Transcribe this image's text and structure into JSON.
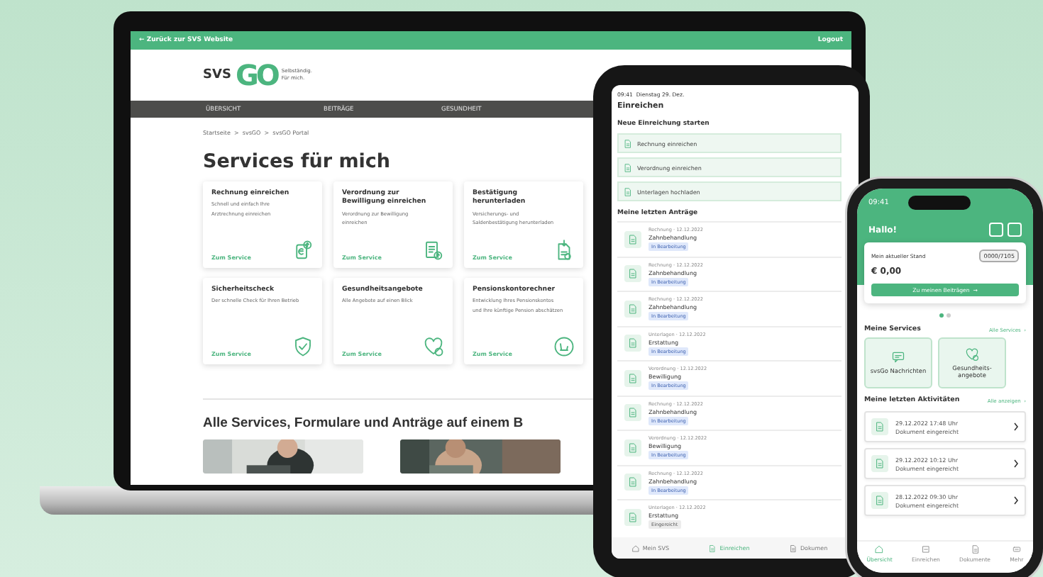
{
  "laptop": {
    "top_bar": {
      "back_link": "← Zurück zur SVS Website",
      "logout": "Logout"
    },
    "logo": {
      "brand": "SVS",
      "mark": "GO",
      "tagline": "Selbständig. Für mich."
    },
    "nav": [
      "ÜBERSICHT",
      "BEITRÄGE",
      "GESUNDHEIT"
    ],
    "breadcrumb": "Startseite  >  svsGO  >  svsGO Portal",
    "heading": "Services für mich",
    "services": [
      {
        "title": "Rechnung einreichen",
        "description": "Schnell und einfach Ihre Arztrechnung einreichen",
        "link": "Zum Service",
        "kind": "invoice"
      },
      {
        "title": "Verordnung zur Bewilligung einreichen",
        "description": "Verordnung zur Bewilligung einreichen",
        "link": "Zum Service",
        "kind": "prescription"
      },
      {
        "title": "Bestätigung herunterladen",
        "description": "Versicherungs- und Saldenbestätigung herunterladen",
        "link": "Zum Service",
        "kind": "download"
      },
      {
        "title": "Sicherheitscheck",
        "description": "Der schnelle Check für Ihren Betrieb",
        "link": "Zum Service",
        "kind": "shield"
      },
      {
        "title": "Gesundheitsangebote",
        "description": "Alle Angebote auf einen Blick",
        "link": "Zum Service",
        "kind": "heart"
      },
      {
        "title": "Pensionskontorechner",
        "description": "Entwicklung Ihres Pensionskontos und Ihre künftige Pension abschätzen",
        "link": "Zum Service",
        "kind": "pension"
      }
    ],
    "section_heading": "Alle Services, Formulare und Anträge auf einem B",
    "photos": [
      {
        "kind": "picture"
      },
      {
        "kind": "picture"
      }
    ]
  },
  "tablet": {
    "status": "09:41  Dienstag 29. Dez.",
    "title": "Einreichen",
    "start_heading": "Neue Einreichung starten",
    "actions": [
      "Rechnung einreichen",
      "Verordnung einreichen",
      "Unterlagen hochladen"
    ],
    "recent_heading": "Meine letzten Anträge",
    "requests": [
      {
        "meta": "Rechnung · 12.12.2022",
        "title": "Zahnbehandlung",
        "status": "In Bearbeitung",
        "kind": "in_progress"
      },
      {
        "meta": "Rechnung · 12.12.2022",
        "title": "Zahnbehandlung",
        "status": "In Bearbeitung",
        "kind": "in_progress"
      },
      {
        "meta": "Rechnung · 12.12.2022",
        "title": "Zahnbehandlung",
        "status": "In Bearbeitung",
        "kind": "in_progress"
      },
      {
        "meta": "Unterlagen · 12.12.2022",
        "title": "Erstattung",
        "status": "In Bearbeitung",
        "kind": "in_progress"
      },
      {
        "meta": "Verordnung · 12.12.2022",
        "title": "Bewilligung",
        "status": "In Bearbeitung",
        "kind": "in_progress"
      },
      {
        "meta": "Rechnung · 12.12.2022",
        "title": "Zahnbehandlung",
        "status": "In Bearbeitung",
        "kind": "in_progress"
      },
      {
        "meta": "Verordnung · 12.12.2022",
        "title": "Bewilligung",
        "status": "In Bearbeitung",
        "kind": "in_progress"
      },
      {
        "meta": "Rechnung · 12.12.2022",
        "title": "Zahnbehandlung",
        "status": "In Bearbeitung",
        "kind": "in_progress"
      },
      {
        "meta": "Unterlagen · 12.12.2022",
        "title": "Erstattung",
        "status": "Eingereicht",
        "kind": "submitted"
      }
    ],
    "tabs": [
      {
        "label": "Mein SVS",
        "kind": "home",
        "selected": false
      },
      {
        "label": "Einreichen",
        "kind": "doc",
        "selected": true
      },
      {
        "label": "Dokumen",
        "kind": "doc",
        "selected": false
      }
    ]
  },
  "phone": {
    "time": "09:41",
    "greeting": "Hallo!",
    "balance": {
      "label": "Mein aktueller Stand",
      "amount": "€ 0,00",
      "badge": "0000/7105",
      "button": "Zu meinen Beiträgen  →"
    },
    "pager": [
      {
        "selected": true
      },
      {
        "selected": false
      }
    ],
    "services_heading": "Meine Services",
    "services_link": "Alle Services  ›",
    "tiles": [
      {
        "label": "svsGo Nachrichten",
        "kind": "chat"
      },
      {
        "label": "Gesundheits-angebote",
        "kind": "heart"
      }
    ],
    "activities_heading": "Meine letzten Aktivitäten",
    "activities_link": "Alle anzeigen  ›",
    "activities": [
      {
        "date": "29.12.2022 17:48 Uhr",
        "title": "Dokument eingereicht"
      },
      {
        "date": "29.12.2022 10:12 Uhr",
        "title": "Dokument eingereicht"
      },
      {
        "date": "28.12.2022 09:30 Uhr",
        "title": "Dokument eingereicht"
      }
    ],
    "nav": [
      {
        "label": "Übersicht",
        "kind": "home",
        "selected": true
      },
      {
        "label": "Einreichen",
        "kind": "scan",
        "selected": false
      },
      {
        "label": "Dokumente",
        "kind": "doc",
        "selected": false
      },
      {
        "label": "Mehr",
        "kind": "more",
        "selected": false
      }
    ]
  }
}
